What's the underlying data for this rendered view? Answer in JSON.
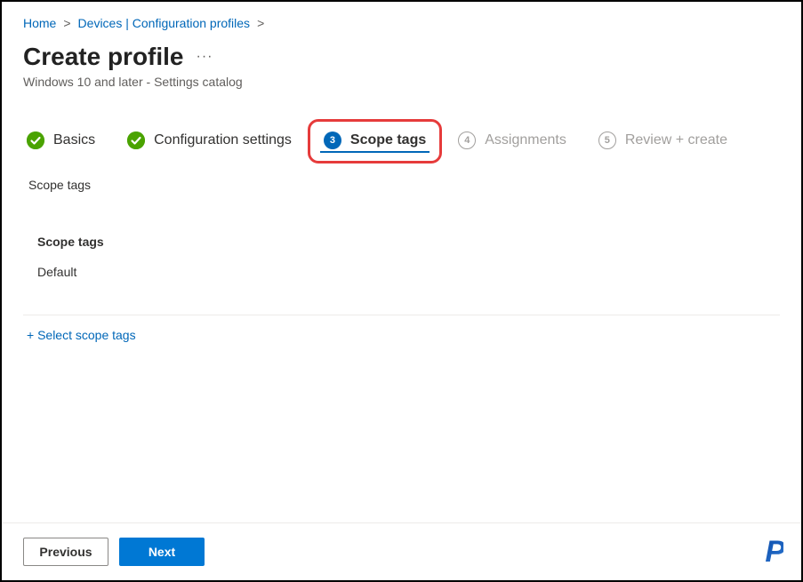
{
  "breadcrumb": {
    "home": "Home",
    "devices": "Devices | Configuration profiles"
  },
  "page": {
    "title": "Create profile",
    "subtitle": "Windows 10 and later - Settings catalog"
  },
  "steps": {
    "s1": {
      "label": "Basics"
    },
    "s2": {
      "label": "Configuration settings"
    },
    "s3": {
      "num": "3",
      "label": "Scope tags"
    },
    "s4": {
      "num": "4",
      "label": "Assignments"
    },
    "s5": {
      "num": "5",
      "label": "Review + create"
    }
  },
  "section": {
    "heading": "Scope tags",
    "sub": "Scope tags",
    "value": "Default",
    "add_link": "+ Select scope tags"
  },
  "footer": {
    "prev": "Previous",
    "next": "Next"
  },
  "logo": "P"
}
